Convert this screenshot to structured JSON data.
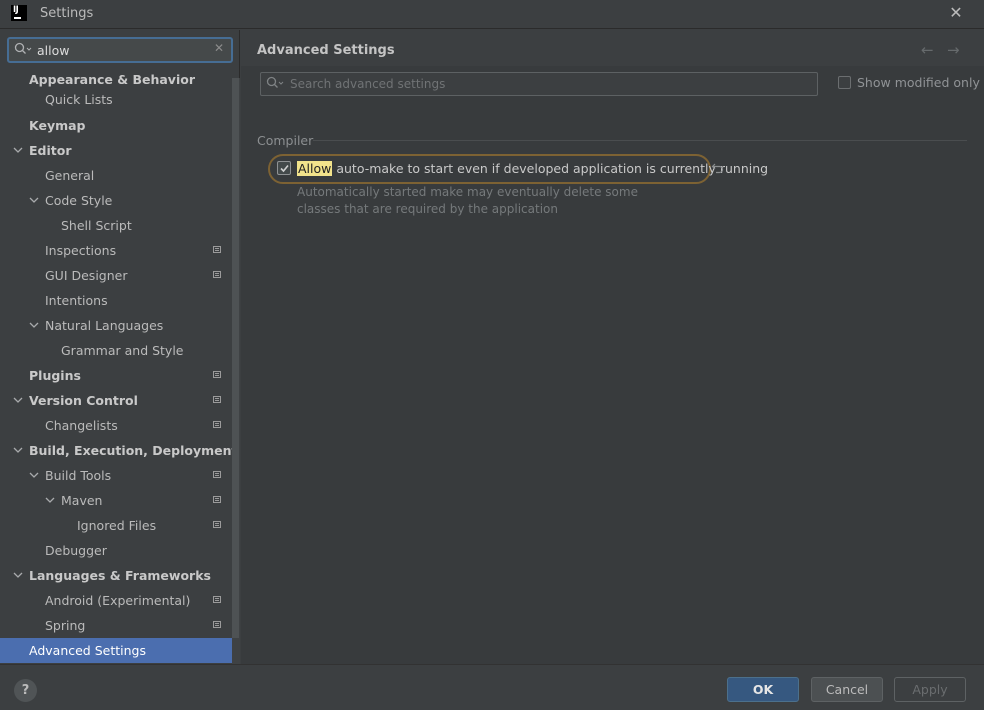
{
  "window": {
    "title": "Settings",
    "app_icon_text": "IJ"
  },
  "sidebar": {
    "search": {
      "value": "allow",
      "placeholder": ""
    },
    "items": [
      {
        "label": "Appearance & Behavior",
        "bold": true
      },
      {
        "label": "Quick Lists"
      },
      {
        "label": "Keymap",
        "bold": true
      },
      {
        "label": "Editor",
        "bold": true
      },
      {
        "label": "General"
      },
      {
        "label": "Code Style"
      },
      {
        "label": "Shell Script"
      },
      {
        "label": "Inspections"
      },
      {
        "label": "GUI Designer"
      },
      {
        "label": "Intentions"
      },
      {
        "label": "Natural Languages"
      },
      {
        "label": "Grammar and Style"
      },
      {
        "label": "Plugins",
        "bold": true
      },
      {
        "label": "Version Control",
        "bold": true
      },
      {
        "label": "Changelists"
      },
      {
        "label": "Build, Execution, Deployment",
        "bold": true
      },
      {
        "label": "Build Tools"
      },
      {
        "label": "Maven"
      },
      {
        "label": "Ignored Files"
      },
      {
        "label": "Debugger"
      },
      {
        "label": "Languages & Frameworks",
        "bold": true
      },
      {
        "label": "Android (Experimental)"
      },
      {
        "label": "Spring"
      },
      {
        "label": "Advanced Settings",
        "bold": true,
        "selected": true
      }
    ]
  },
  "main": {
    "title": "Advanced Settings",
    "search_placeholder": "Search advanced settings",
    "show_modified_label": "Show modified only",
    "section": "Compiler",
    "option": {
      "highlight": "Allow",
      "rest": " auto-make to start even if developed application is currently running",
      "checked": true,
      "description": "Automatically started make may eventually delete some classes that are required by the application"
    }
  },
  "footer": {
    "help_label": "?",
    "ok_label": "OK",
    "cancel_label": "Cancel",
    "apply_label": "Apply"
  },
  "colors": {
    "background": "#3c3f41",
    "selection": "#4b6eaf",
    "search_highlight": "#f2e38b",
    "ok_button": "#365880"
  }
}
